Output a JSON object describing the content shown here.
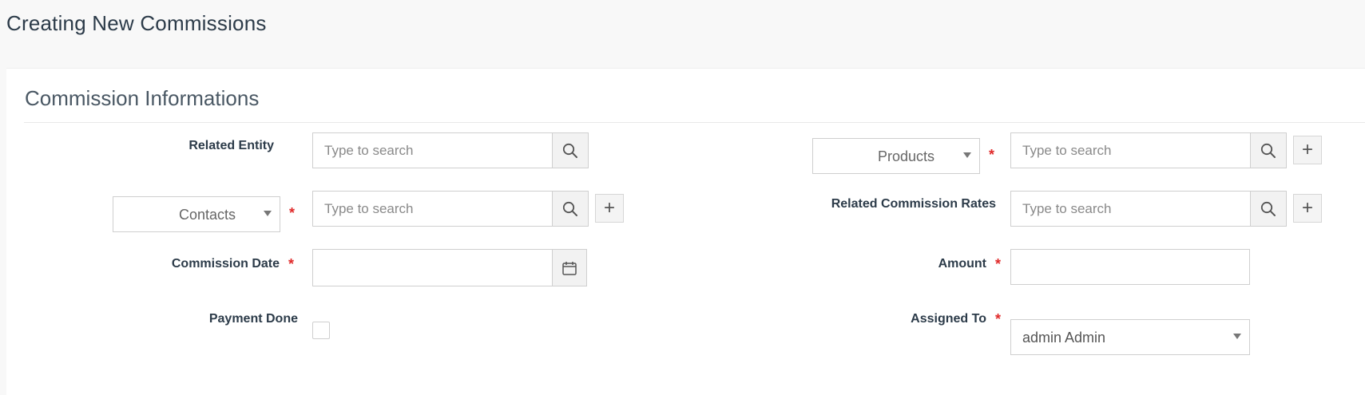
{
  "page": {
    "title": "Creating New Commissions"
  },
  "section": {
    "title": "Commission Informations"
  },
  "fields": {
    "related_entity": {
      "label": "Related Entity",
      "placeholder": "Type to search"
    },
    "products": {
      "selected": "Products",
      "placeholder": "Type to search",
      "required_mark": "*"
    },
    "contacts": {
      "selected": "Contacts",
      "placeholder": "Type to search",
      "required_mark": "*"
    },
    "related_commission_rates": {
      "label": "Related Commission Rates",
      "placeholder": "Type to search"
    },
    "commission_date": {
      "label": "Commission Date",
      "required_mark": "*",
      "value": ""
    },
    "amount": {
      "label": "Amount",
      "required_mark": "*",
      "value": ""
    },
    "payment_done": {
      "label": "Payment Done",
      "checked": false
    },
    "assigned_to": {
      "label": "Assigned To",
      "required_mark": "*",
      "selected": "admin Admin"
    }
  },
  "buttons": {
    "add_symbol": "+"
  },
  "icons": {
    "search": "search-icon",
    "calendar": "calendar-icon",
    "caret": "caret-down-icon",
    "add": "plus-icon"
  },
  "colors": {
    "required": "#e02a2a",
    "text": "#2c3b49",
    "border": "#cfcfcf",
    "addon_bg": "#f2f2f2"
  }
}
